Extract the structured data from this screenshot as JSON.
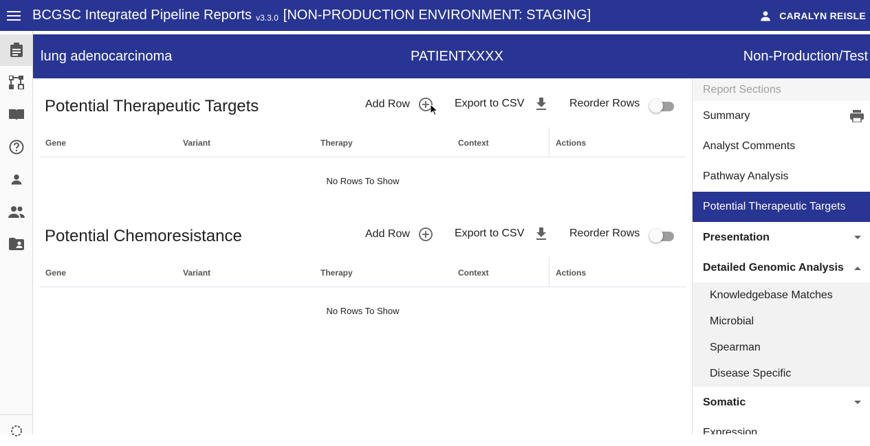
{
  "appbar": {
    "title": "BCGSC Integrated Pipeline Reports",
    "version": "v3.3.0",
    "environment": "[NON-PRODUCTION ENVIRONMENT: STAGING]",
    "user": "CARALYN REISLE",
    "color": "#283593"
  },
  "rail": {
    "icons": [
      "report-icon",
      "genomic-icon",
      "book-icon",
      "help-icon",
      "person-icon",
      "people-icon",
      "folder-shared-icon",
      "biology-icon"
    ]
  },
  "banner": {
    "disease": "lung adenocarcinoma",
    "patient": "PATIENTXXXX",
    "status": "Non-Production/Test"
  },
  "sections": [
    {
      "title": "Potential Therapeutic Targets",
      "add_row": "Add Row",
      "export": "Export to CSV",
      "reorder": "Reorder Rows",
      "columns": [
        "Gene",
        "Variant",
        "Therapy",
        "Context",
        "Actions"
      ],
      "empty": "No Rows To Show"
    },
    {
      "title": "Potential Chemoresistance",
      "add_row": "Add Row",
      "export": "Export to CSV",
      "reorder": "Reorder Rows",
      "columns": [
        "Gene",
        "Variant",
        "Therapy",
        "Context",
        "Actions"
      ],
      "empty": "No Rows To Show"
    }
  ],
  "sidebar": {
    "header": "Report Sections",
    "items": [
      "Summary",
      "Analyst Comments",
      "Pathway Analysis",
      "Potential Therapeutic Targets"
    ],
    "active": "Potential Therapeutic Targets",
    "groups": [
      {
        "label": "Presentation",
        "expanded": false
      },
      {
        "label": "Detailed Genomic Analysis",
        "expanded": true,
        "children": [
          "Knowledgebase Matches",
          "Microbial",
          "Spearman",
          "Disease Specific"
        ]
      },
      {
        "label": "Somatic",
        "expanded": false
      }
    ],
    "partial_item": "Expression"
  }
}
